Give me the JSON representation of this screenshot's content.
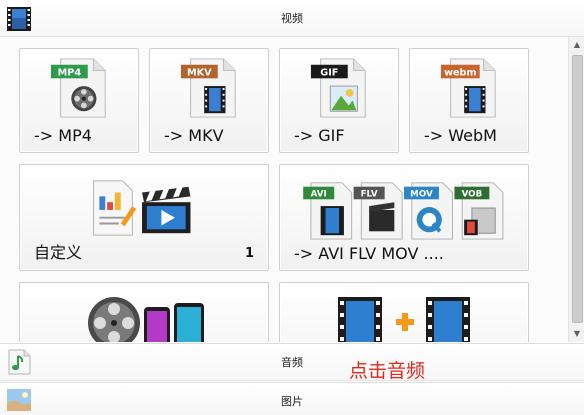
{
  "sections": {
    "video": {
      "title": "视频",
      "icon": "film-strip-icon"
    },
    "audio": {
      "title": "音频",
      "icon": "music-note-icon"
    },
    "image": {
      "title": "图片",
      "icon": "landscape-picture-icon"
    }
  },
  "tiles": [
    {
      "label": "-> MP4",
      "badge": "MP4",
      "badge_color": "#2f9a4c",
      "icon": "film-reel-file-icon"
    },
    {
      "label": "-> MKV",
      "badge": "MKV",
      "badge_color": "#b2642f",
      "icon": "film-strip-file-icon"
    },
    {
      "label": "-> GIF",
      "badge": "GIF",
      "badge_color": "#1a1a1a",
      "icon": "picture-file-icon"
    },
    {
      "label": "-> WebM",
      "badge": "webm",
      "badge_color": "#c8652b",
      "icon": "film-strip-file-icon"
    },
    {
      "label": "自定义",
      "count": "1",
      "icon": "document-and-clapperboard-icon"
    },
    {
      "label": "-> AVI FLV MOV ....",
      "badges": [
        "AVI",
        "FLV",
        "MOV",
        "VOB"
      ],
      "badge_colors": [
        "#2f8a3a",
        "#555555",
        "#2c86c6",
        "#2f6e33"
      ],
      "icon": "multi-format-files-icon"
    },
    {
      "label": "",
      "icon": "film-reel-and-phones-icon"
    },
    {
      "label": "",
      "icon": "film-plus-film-icon"
    }
  ],
  "hint_text": "点击音频",
  "colors": {
    "hint": "#e0281c",
    "tile_border": "#cfcfcf",
    "accent_orange": "#f39a1c"
  }
}
